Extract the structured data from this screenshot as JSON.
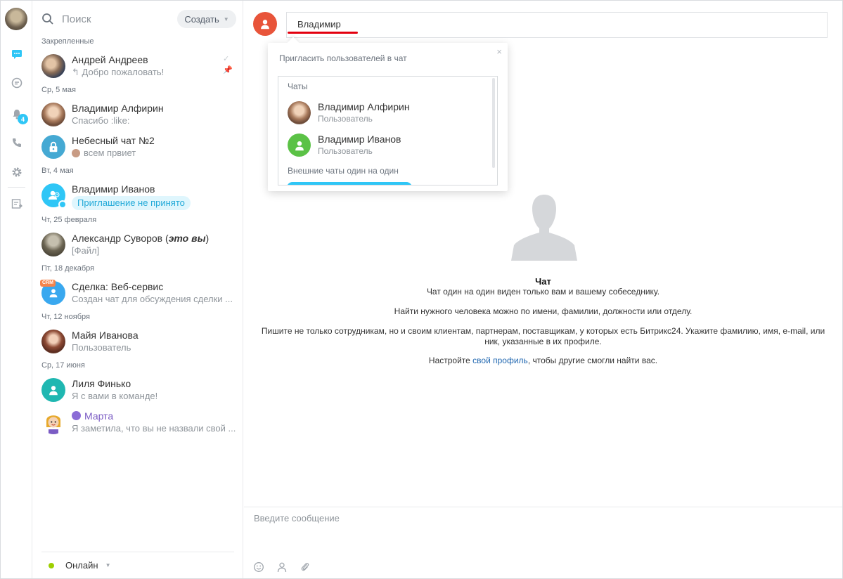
{
  "search": {
    "placeholder": "Поиск"
  },
  "create_button": {
    "label": "Создать"
  },
  "groups": {
    "pinned": "Закрепленные",
    "g1": "Ср, 5 мая",
    "g2": "Вт, 4 мая",
    "g3": "Чт, 25 февраля",
    "g4": "Пт, 18 декабря",
    "g5": "Чт, 12 ноября",
    "g6": "Ср, 17 июня"
  },
  "chats": [
    {
      "name": "Андрей Андреев",
      "message": "Добро пожаловать!"
    },
    {
      "name": "Владимир Алфирин",
      "message": "Спасибо :like:"
    },
    {
      "name": "Небесный чат №2",
      "message": "всем првиет"
    },
    {
      "name": "Владимир Иванов",
      "message": "Приглашение не принято"
    },
    {
      "name_prefix": "Александр Суворов (",
      "name_em": "это вы",
      "name_suffix": ")",
      "message": "[Файл]"
    },
    {
      "name": "Сделка: Веб-сервис",
      "message": "Создан чат для обсуждения сделки ...",
      "badge": "CRM"
    },
    {
      "name": "Майя Иванова",
      "message": "Пользователь"
    },
    {
      "name": "Лиля Финько",
      "message": "Я с вами в команде!"
    },
    {
      "name": "Марта",
      "message": "Я заметила, что вы не назвали свой ..."
    }
  ],
  "status": {
    "label": "Онлайн"
  },
  "recipient": {
    "value": "Владимир"
  },
  "invite_popup": {
    "title": "Пригласить пользователей в чат",
    "close": "×",
    "section_chats": "Чаты",
    "section_external": "Внешние чаты один на один",
    "items": [
      {
        "name": "Владимир Алфирин",
        "role": "Пользователь"
      },
      {
        "name": "Владимир Иванов",
        "role": "Пользователь"
      }
    ]
  },
  "empty_state": {
    "title": "Чат",
    "line1": "Чат один на один виден только вам и вашему собеседнику.",
    "line2": "Найти нужного человека можно по имени, фамилии, должности или отделу.",
    "line3": "Пишите не только сотрудникам, но и своим клиентам, партнерам, поставщикам, у которых есть Битрикс24. Укажите фамилию, имя, e-mail, или ник, указанные в их профиле.",
    "line4_before": "Настройте ",
    "line4_link": "свой профиль",
    "line4_after": ", чтобы другие смогли найти вас."
  },
  "composer": {
    "placeholder": "Введите сообщение"
  },
  "rail": {
    "notifications_count": "4"
  },
  "icons": {
    "rail": [
      "user-avatar",
      "chat-icon",
      "open-lines-icon",
      "bell-icon",
      "phone-icon",
      "settings-icon",
      "export-icon"
    ],
    "composer": [
      "smile-icon",
      "user-icon",
      "paperclip-icon"
    ]
  },
  "colors": {
    "accent": "#2fc6f6",
    "online": "#9dcf00",
    "underline": "#e3000f",
    "link": "#2067b0"
  }
}
